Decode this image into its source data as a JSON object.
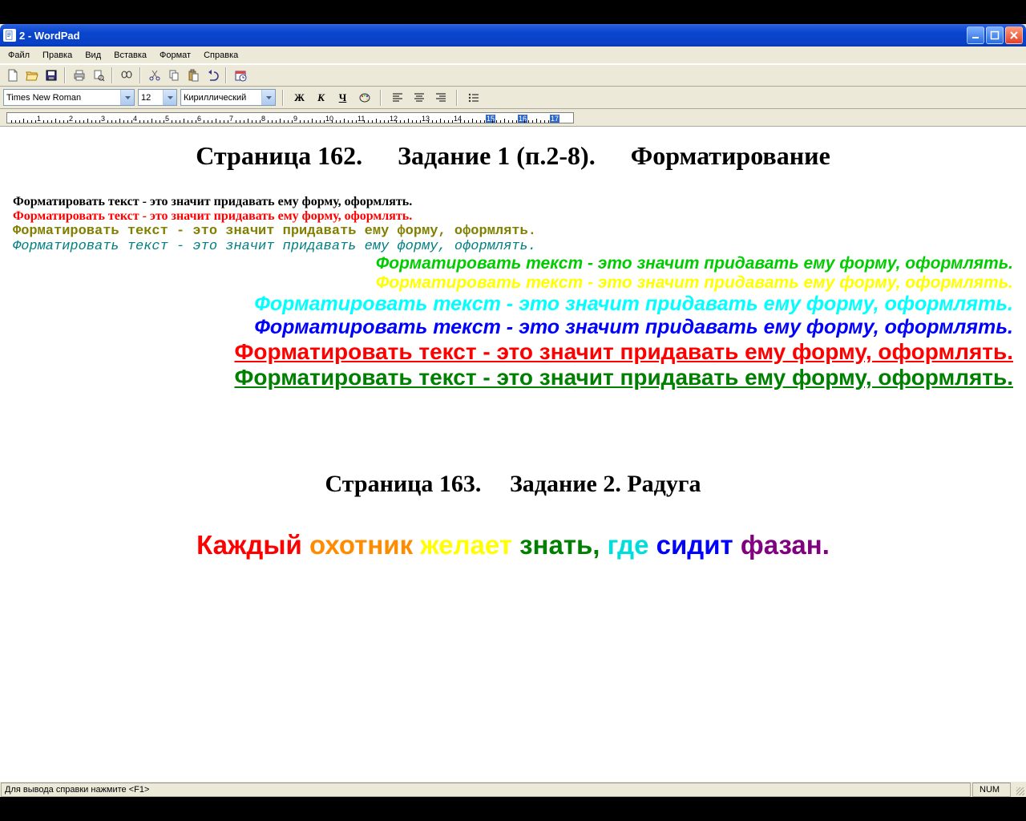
{
  "window": {
    "title": "2 - WordPad"
  },
  "menu": {
    "items": [
      "Файл",
      "Правка",
      "Вид",
      "Вставка",
      "Формат",
      "Справка"
    ]
  },
  "format": {
    "font_name": "Times New Roman",
    "font_size": "12",
    "script": "Кириллический",
    "bold_label": "Ж",
    "italic_label": "К",
    "underline_label": "Ч"
  },
  "doc": {
    "heading1_a": "Страница 162.",
    "heading1_b": "Задание 1 (п.2-8).",
    "heading1_c": "Форматирование",
    "line1": "Форматировать текст - это значит придавать ему форму, оформлять.",
    "line2": "Форматировать текст - это значит придавать ему форму, оформлять.",
    "line3": "Форматировать текст - это значит придавать ему форму, оформлять.",
    "line4": "Форматировать текст - это значит придавать ему форму, оформлять.",
    "line5": "Форматировать текст - это значит придавать ему форму, оформлять.",
    "line6": "Форматировать текст - это значит придавать ему форму, оформлять.",
    "line7": "Форматировать текст - это значит придавать ему форму, оформлять.",
    "line8": "Форматировать текст - это значит придавать ему форму, оформлять.",
    "line9": "Форматировать текст - это значит придавать ему форму, оформлять.",
    "line10": "Форматировать текст - это значит придавать ему форму, оформлять.",
    "heading2_a": "Страница 163.",
    "heading2_b": "Задание 2. Радуга",
    "rainbow": [
      {
        "text": "Каждый ",
        "color": "#ff0000"
      },
      {
        "text": "охотник ",
        "color": "#ff8c00"
      },
      {
        "text": "желает ",
        "color": "#ffff00"
      },
      {
        "text": "знать, ",
        "color": "#008000"
      },
      {
        "text": "где ",
        "color": "#00dddd"
      },
      {
        "text": "сидит ",
        "color": "#0000ff"
      },
      {
        "text": "фазан.",
        "color": "#800080"
      }
    ]
  },
  "status": {
    "help": "Для вывода справки нажмите <F1>",
    "num": "NUM"
  },
  "ruler": {
    "max": 17,
    "highlight_start": 15
  }
}
